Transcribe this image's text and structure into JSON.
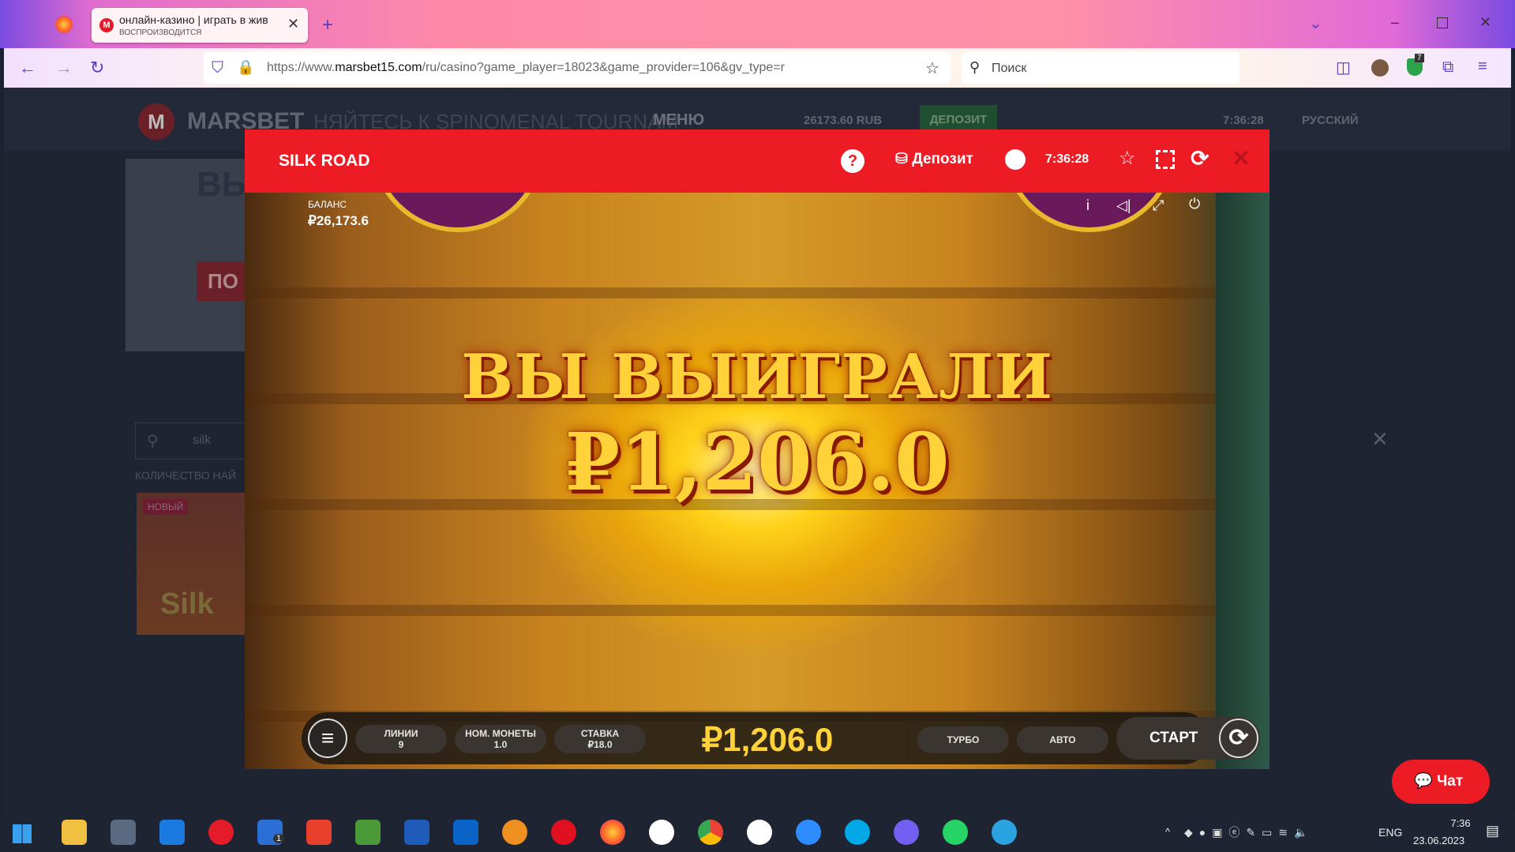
{
  "browser": {
    "tab_title": "онлайн-казино | играть в жив",
    "tab_status": "ВОСПРОИЗВОДИТСЯ",
    "url_prefix": "https://www.",
    "url_domain": "marsbet15.com",
    "url_rest": "/ru/casino?game_player=18023&game_provider=106&gv_type=r",
    "search_placeholder": "Поиск",
    "extension_badge": "7"
  },
  "site": {
    "logo": "MARSBET",
    "banner_text": "НЯЙТЕСЬ К SPINOMENAL TOURNAM",
    "menu": "МЕНЮ",
    "balance": "26173.60 RUB",
    "deposit": "ДЕПОЗИТ",
    "time": "7:36:28",
    "language": "РУССКИЙ",
    "promo_heading": "ВЫ",
    "promo_button": "ПО",
    "search_value": "silk",
    "results_label": "КОЛИЧЕСТВО НАЙ",
    "badge_new": "НОВЫЙ",
    "game_thumb": "Silk"
  },
  "modal": {
    "title": "SILK ROAD",
    "deposit": "Депозит",
    "time": "7:36:28"
  },
  "game": {
    "balance_label": "БАЛАНС",
    "balance": "₽26,173.6",
    "win_title": "ВЫ ВЫИГРАЛИ",
    "win_amount": "₽1,206.0",
    "controls": {
      "lines_label": "ЛИНИИ",
      "lines": "9",
      "coin_label": "НОМ. МОНЕТЫ",
      "coin": "1.0",
      "bet_label": "СТАВКА",
      "bet": "₽18.0",
      "win": "₽1,206.0",
      "turbo": "ТУРБО",
      "auto": "АВТО",
      "start": "СТАРТ"
    }
  },
  "chat": {
    "label": "Чат"
  },
  "taskbar": {
    "lang": "ENG",
    "time": "7:36",
    "date": "23.06.2023",
    "todo_badge": "1"
  },
  "colors": {
    "brand": "#ed1c24",
    "gold": "#ffd23a"
  }
}
